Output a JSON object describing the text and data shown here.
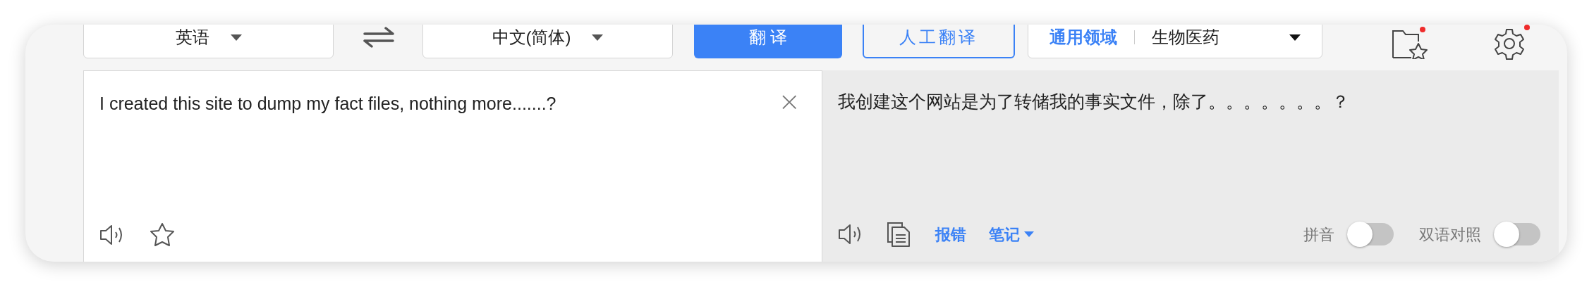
{
  "toolbar": {
    "source_language": "英语",
    "target_language": "中文(简体)",
    "translate_button": "翻 译",
    "human_translate_button": "人工翻译",
    "domain": {
      "label": "通用领域",
      "value": "生物医药"
    },
    "favorites_badge": true,
    "settings_badge": true
  },
  "input": {
    "value": "I created this site to dump my fact files, nothing more.......?",
    "clear": "×"
  },
  "output": {
    "text": "我创建这个网站是为了转储我的事实文件，除了。。。。。。。？",
    "links": [
      {
        "label": "报错",
        "caret": false
      },
      {
        "label": "笔记",
        "caret": true
      }
    ],
    "toggles": [
      {
        "label": "拼音",
        "on": false
      },
      {
        "label": "双语对照",
        "on": false
      }
    ]
  }
}
